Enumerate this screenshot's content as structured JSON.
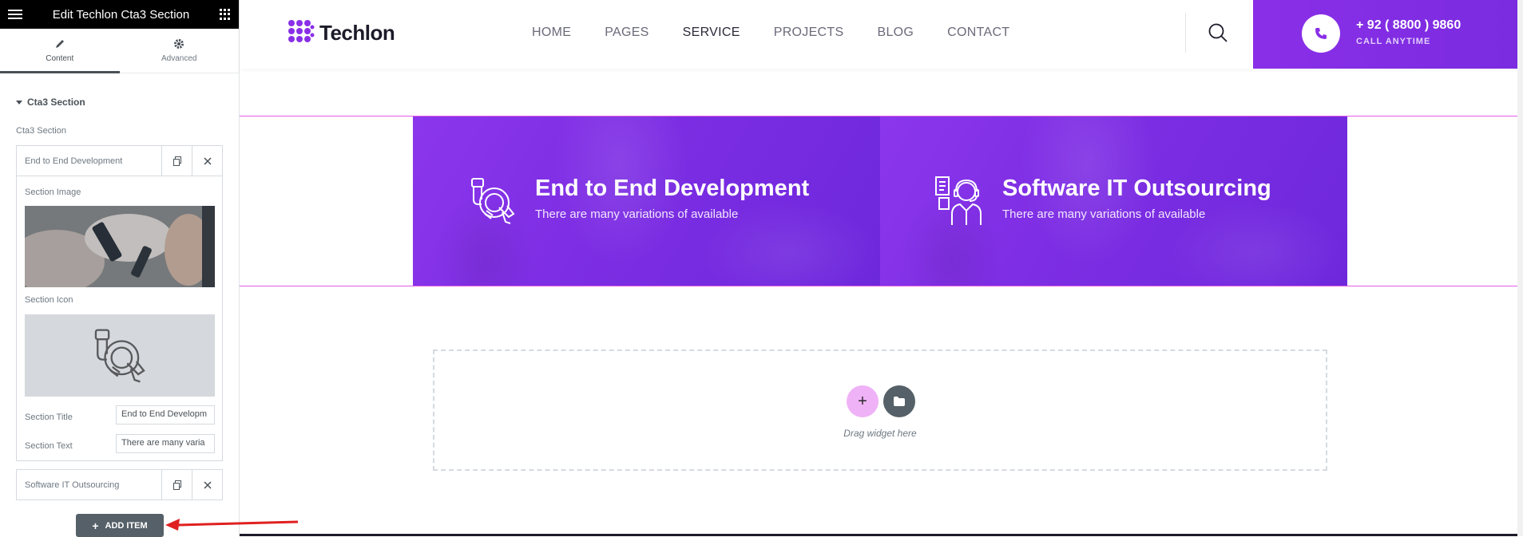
{
  "editor": {
    "title": "Edit Techlon Cta3 Section",
    "tabs": [
      {
        "label": "Content",
        "icon": "pencil-icon",
        "active": true
      },
      {
        "label": "Advanced",
        "icon": "gear-icon",
        "active": false
      }
    ],
    "section_heading": "Cta3 Section",
    "repeater_label": "Cta3 Section",
    "items": [
      {
        "title": "End to End Development"
      },
      {
        "title": "Software IT Outsourcing"
      }
    ],
    "fields": {
      "section_image_label": "Section Image",
      "section_icon_label": "Section Icon",
      "section_title_label": "Section Title",
      "section_title_value": "End to End Developm",
      "section_text_label": "Section Text",
      "section_text_value": "There are many varia"
    },
    "add_item_label": "ADD ITEM"
  },
  "site": {
    "logo": "Techlon",
    "nav": [
      "HOME",
      "PAGES",
      "SERVICE",
      "PROJECTS",
      "BLOG",
      "CONTACT"
    ],
    "current_nav": "SERVICE",
    "phone": "+ 92 ( 8800 ) 9860",
    "phone_sub": "CALL ANYTIME",
    "cta": [
      {
        "title": "End to End Development",
        "text": "There are many variations of available",
        "icon": "handshake-cycle-icon"
      },
      {
        "title": "Software IT Outsourcing",
        "text": "There are many variations of available",
        "icon": "support-agent-icon"
      }
    ],
    "drop_zone_text": "Drag widget here"
  },
  "colors": {
    "accent": "#8a2fe8",
    "editor_dark": "#556068",
    "outline": "#e05ce8",
    "arrow": "#e02020"
  }
}
